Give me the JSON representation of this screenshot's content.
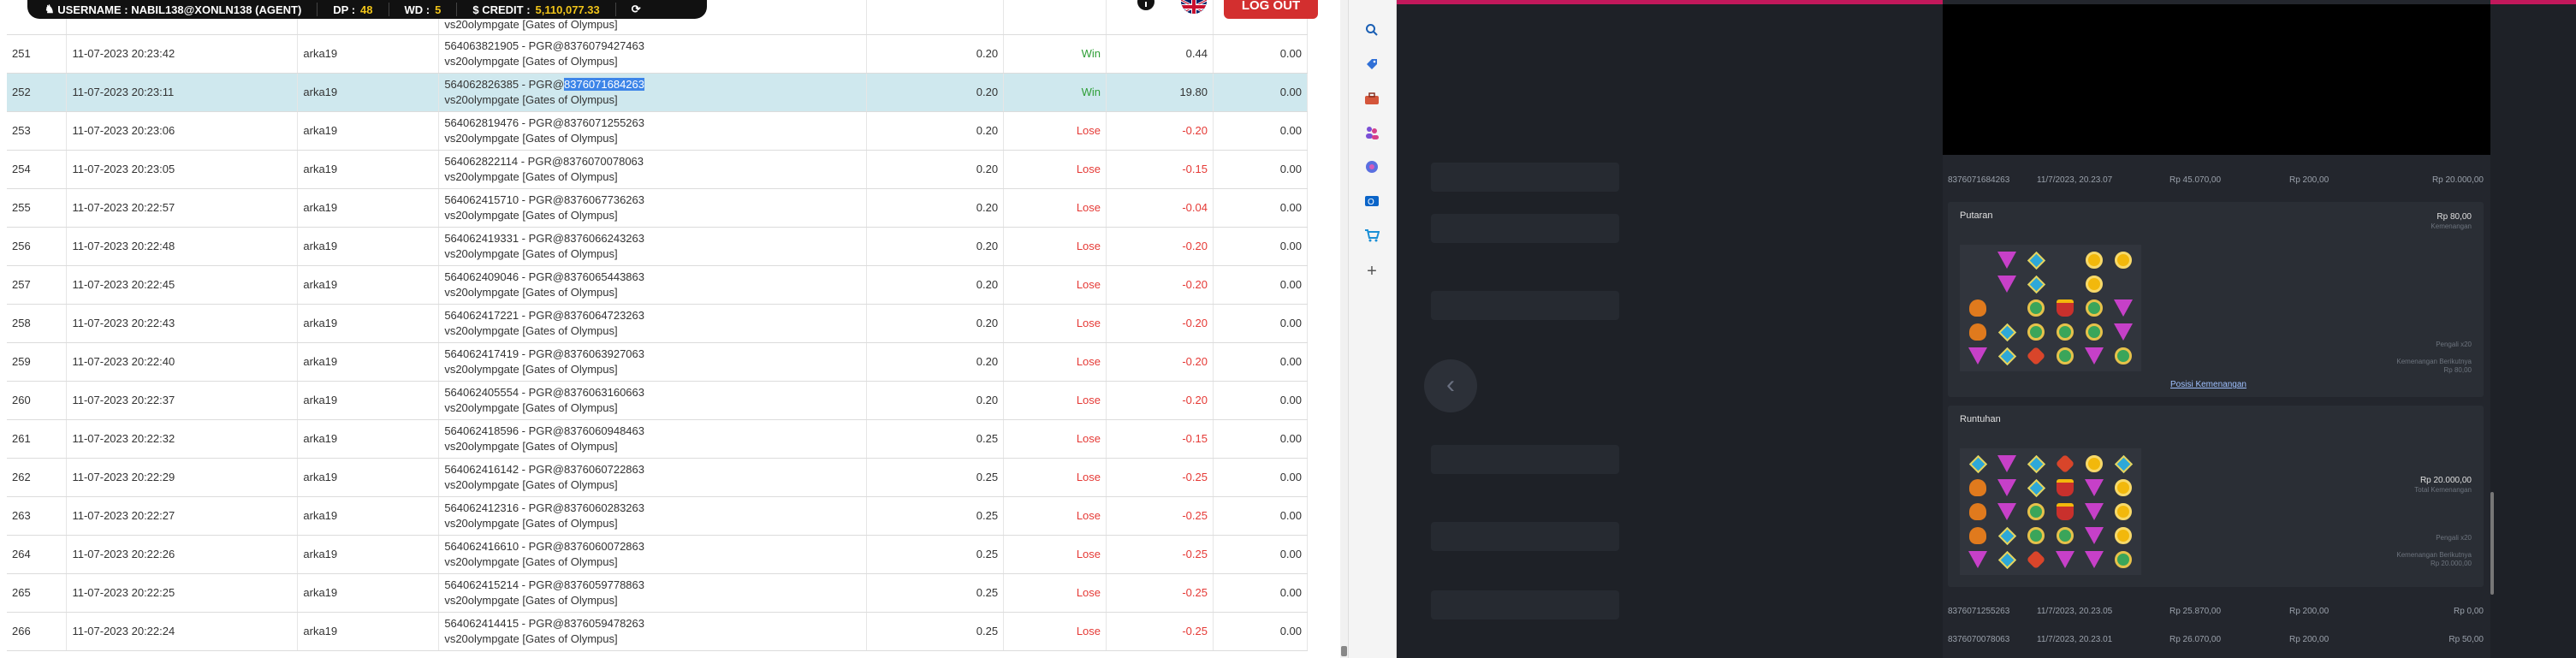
{
  "topbar": {
    "username_label": "USERNAME : NABIL138@XONLN138 (AGENT)",
    "dp_label": "DP :",
    "dp_value": "48",
    "wd_label": "WD :",
    "wd_value": "5",
    "credit_label": "$ CREDIT :",
    "credit_value": "5,110,077.33",
    "logout_label": "LOG OUT"
  },
  "table": {
    "partial_row": {
      "desc_line2": "vs20olympgate [Gates of Olympus]"
    },
    "rows": [
      {
        "no": "251",
        "date": "11-07-2023 20:23:42",
        "user": "arka19",
        "desc1": "564063821905 - PGR@8376079427463",
        "desc2": "vs20olympgate [Gates of Olympus]",
        "bet": "0.20",
        "result": "Win",
        "win": "0.44",
        "last": "0.00"
      },
      {
        "no": "252",
        "date": "11-07-2023 20:23:11",
        "user": "arka19",
        "desc1_pre": "564062826385 - PGR@",
        "desc1_sel": "8376071684263",
        "desc2": "vs20olympgate [Gates of Olympus]",
        "bet": "0.20",
        "result": "Win",
        "win": "19.80",
        "last": "0.00"
      },
      {
        "no": "253",
        "date": "11-07-2023 20:23:06",
        "user": "arka19",
        "desc1": "564062819476 - PGR@8376071255263",
        "desc2": "vs20olympgate [Gates of Olympus]",
        "bet": "0.20",
        "result": "Lose",
        "win": "-0.20",
        "last": "0.00"
      },
      {
        "no": "254",
        "date": "11-07-2023 20:23:05",
        "user": "arka19",
        "desc1": "564062822114 - PGR@8376070078063",
        "desc2": "vs20olympgate [Gates of Olympus]",
        "bet": "0.20",
        "result": "Lose",
        "win": "-0.15",
        "last": "0.00"
      },
      {
        "no": "255",
        "date": "11-07-2023 20:22:57",
        "user": "arka19",
        "desc1": "564062415710 - PGR@8376067736263",
        "desc2": "vs20olympgate [Gates of Olympus]",
        "bet": "0.20",
        "result": "Lose",
        "win": "-0.04",
        "last": "0.00"
      },
      {
        "no": "256",
        "date": "11-07-2023 20:22:48",
        "user": "arka19",
        "desc1": "564062419331 - PGR@8376066243263",
        "desc2": "vs20olympgate [Gates of Olympus]",
        "bet": "0.20",
        "result": "Lose",
        "win": "-0.20",
        "last": "0.00"
      },
      {
        "no": "257",
        "date": "11-07-2023 20:22:45",
        "user": "arka19",
        "desc1": "564062409046 - PGR@8376065443863",
        "desc2": "vs20olympgate [Gates of Olympus]",
        "bet": "0.20",
        "result": "Lose",
        "win": "-0.20",
        "last": "0.00"
      },
      {
        "no": "258",
        "date": "11-07-2023 20:22:43",
        "user": "arka19",
        "desc1": "564062417221 - PGR@8376064723263",
        "desc2": "vs20olympgate [Gates of Olympus]",
        "bet": "0.20",
        "result": "Lose",
        "win": "-0.20",
        "last": "0.00"
      },
      {
        "no": "259",
        "date": "11-07-2023 20:22:40",
        "user": "arka19",
        "desc1": "564062417419 - PGR@8376063927063",
        "desc2": "vs20olympgate [Gates of Olympus]",
        "bet": "0.20",
        "result": "Lose",
        "win": "-0.20",
        "last": "0.00"
      },
      {
        "no": "260",
        "date": "11-07-2023 20:22:37",
        "user": "arka19",
        "desc1": "564062405554 - PGR@8376063160663",
        "desc2": "vs20olympgate [Gates of Olympus]",
        "bet": "0.20",
        "result": "Lose",
        "win": "-0.20",
        "last": "0.00"
      },
      {
        "no": "261",
        "date": "11-07-2023 20:22:32",
        "user": "arka19",
        "desc1": "564062418596 - PGR@8376060948463",
        "desc2": "vs20olympgate [Gates of Olympus]",
        "bet": "0.25",
        "result": "Lose",
        "win": "-0.15",
        "last": "0.00"
      },
      {
        "no": "262",
        "date": "11-07-2023 20:22:29",
        "user": "arka19",
        "desc1": "564062416142 - PGR@8376060722863",
        "desc2": "vs20olympgate [Gates of Olympus]",
        "bet": "0.25",
        "result": "Lose",
        "win": "-0.25",
        "last": "0.00"
      },
      {
        "no": "263",
        "date": "11-07-2023 20:22:27",
        "user": "arka19",
        "desc1": "564062412316 - PGR@8376060283263",
        "desc2": "vs20olympgate [Gates of Olympus]",
        "bet": "0.25",
        "result": "Lose",
        "win": "-0.25",
        "last": "0.00"
      },
      {
        "no": "264",
        "date": "11-07-2023 20:22:26",
        "user": "arka19",
        "desc1": "564062416610 - PGR@8376060072863",
        "desc2": "vs20olympgate [Gates of Olympus]",
        "bet": "0.25",
        "result": "Lose",
        "win": "-0.25",
        "last": "0.00"
      },
      {
        "no": "265",
        "date": "11-07-2023 20:22:25",
        "user": "arka19",
        "desc1": "564062415214 - PGR@8376059778863",
        "desc2": "vs20olympgate [Gates of Olympus]",
        "bet": "0.25",
        "result": "Lose",
        "win": "-0.25",
        "last": "0.00"
      },
      {
        "no": "266",
        "date": "11-07-2023 20:22:24",
        "user": "arka19",
        "desc1": "564062414415 - PGR@8376059478263",
        "desc2": "vs20olympgate [Gates of Olympus]",
        "bet": "0.25",
        "result": "Lose",
        "win": "-0.25",
        "last": "0.00"
      }
    ]
  },
  "sidebar": {
    "icons": [
      "search-icon",
      "tag-icon",
      "toolbox-icon",
      "people-icon",
      "copilot-icon",
      "outlook-icon",
      "shopping-icon",
      "plus-icon"
    ]
  },
  "history": {
    "top_rows": [
      {
        "id": "8376071684263",
        "time": "11/7/2023, 20.23.07",
        "a": "Rp 45.070,00",
        "b": "Rp 200,00",
        "c": "Rp 20.000,00"
      }
    ],
    "putaran": {
      "title": "Putaran",
      "amount": "Rp 80,00",
      "amount_sub": "Kemenangan",
      "side_note": "Pengali x20",
      "side_note2": "Kemenangan Berikutnya",
      "side_note3": "Rp 80,00",
      "link": "Posisi Kemenangan"
    },
    "runtuhan": {
      "title": "Runtuhan",
      "amount": "Rp 20.000,00",
      "amount_sub": "Total Kemenangan",
      "side_note": "Pengali x20",
      "side_note2": "Kemenangan Berikutnya",
      "side_note3": "Rp 20.000,00"
    },
    "bottom_rows": [
      {
        "id": "8376071255263",
        "time": "11/7/2023, 20.23.05",
        "a": "Rp 25.870,00",
        "b": "Rp 200,00",
        "c": "Rp 0,00"
      },
      {
        "id": "8376070078063",
        "time": "11/7/2023, 20.23.01",
        "a": "Rp 26.070,00",
        "b": "Rp 200,00",
        "c": "Rp 50,00"
      }
    ]
  },
  "colors": {
    "logout": "#d32f2f",
    "win": "#2e9e36",
    "lose": "#e53935",
    "selected_row": "#cfe8ee",
    "accent_bar": "#c2185b"
  }
}
